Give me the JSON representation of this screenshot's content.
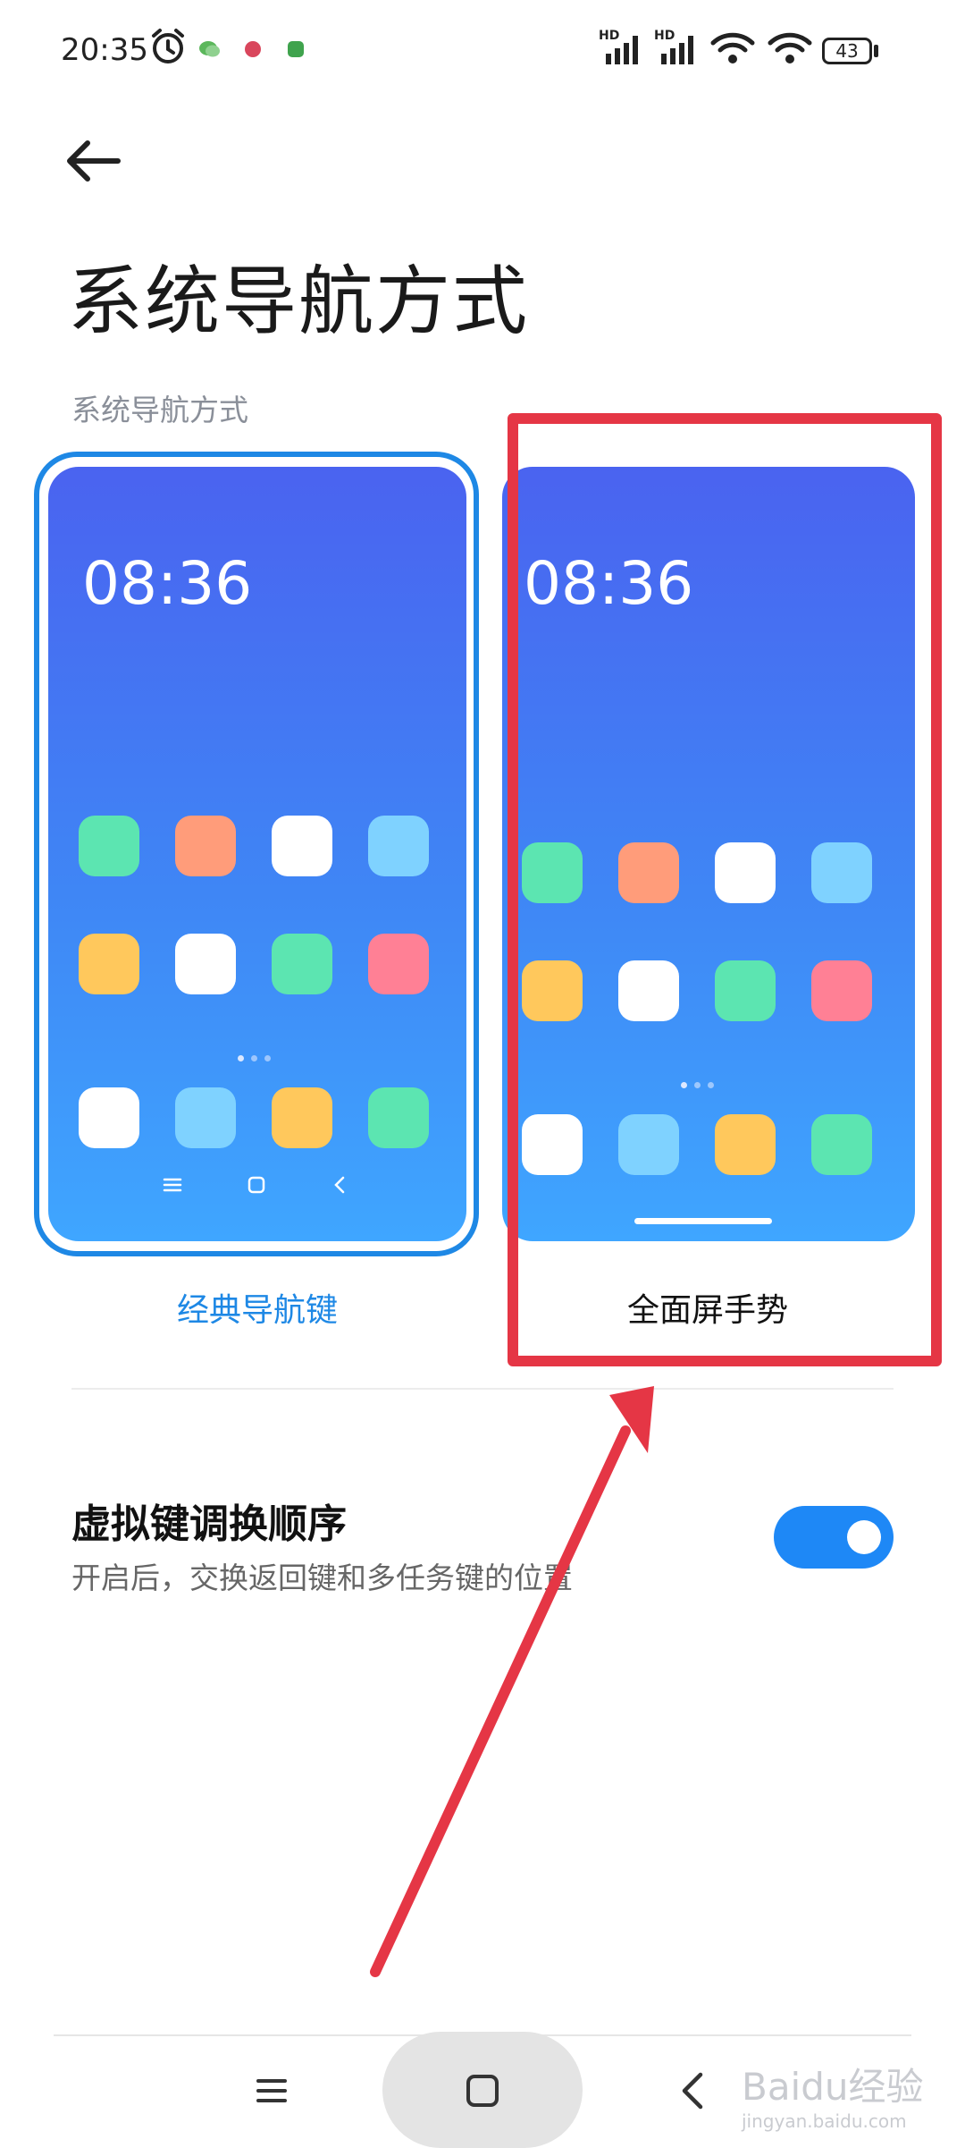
{
  "status_bar": {
    "time": "20:35",
    "battery": "43",
    "icons": [
      "alarm-icon",
      "wechat-icon",
      "app-icon",
      "app-icon",
      "hd-signal-icon",
      "hd-signal-icon",
      "wifi-icon",
      "wifi-icon",
      "battery-icon"
    ]
  },
  "header": {
    "back_icon": "back-arrow-icon",
    "title": "系统导航方式"
  },
  "section": {
    "label": "系统导航方式"
  },
  "options": [
    {
      "label": "经典导航键",
      "selected": true,
      "preview_time": "08:36",
      "nav_icons": [
        "menu-icon",
        "home-icon",
        "back-icon"
      ]
    },
    {
      "label": "全面屏手势",
      "selected": false,
      "preview_time": "08:36",
      "nav_icons": [
        "gesture-bar-icon"
      ]
    }
  ],
  "setting": {
    "title": "虚拟键调换顺序",
    "description": "开启后，交换返回键和多任务键的位置",
    "enabled": true
  },
  "bottom_nav": {
    "icons": [
      "menu-icon",
      "home-icon",
      "back-icon"
    ]
  },
  "watermark": {
    "text": "Baidu经验",
    "sub": "jingyan.baidu.com"
  },
  "colors": {
    "accent": "#1e88e5",
    "highlight": "#e53645",
    "toggle_on": "#1e88f6"
  }
}
